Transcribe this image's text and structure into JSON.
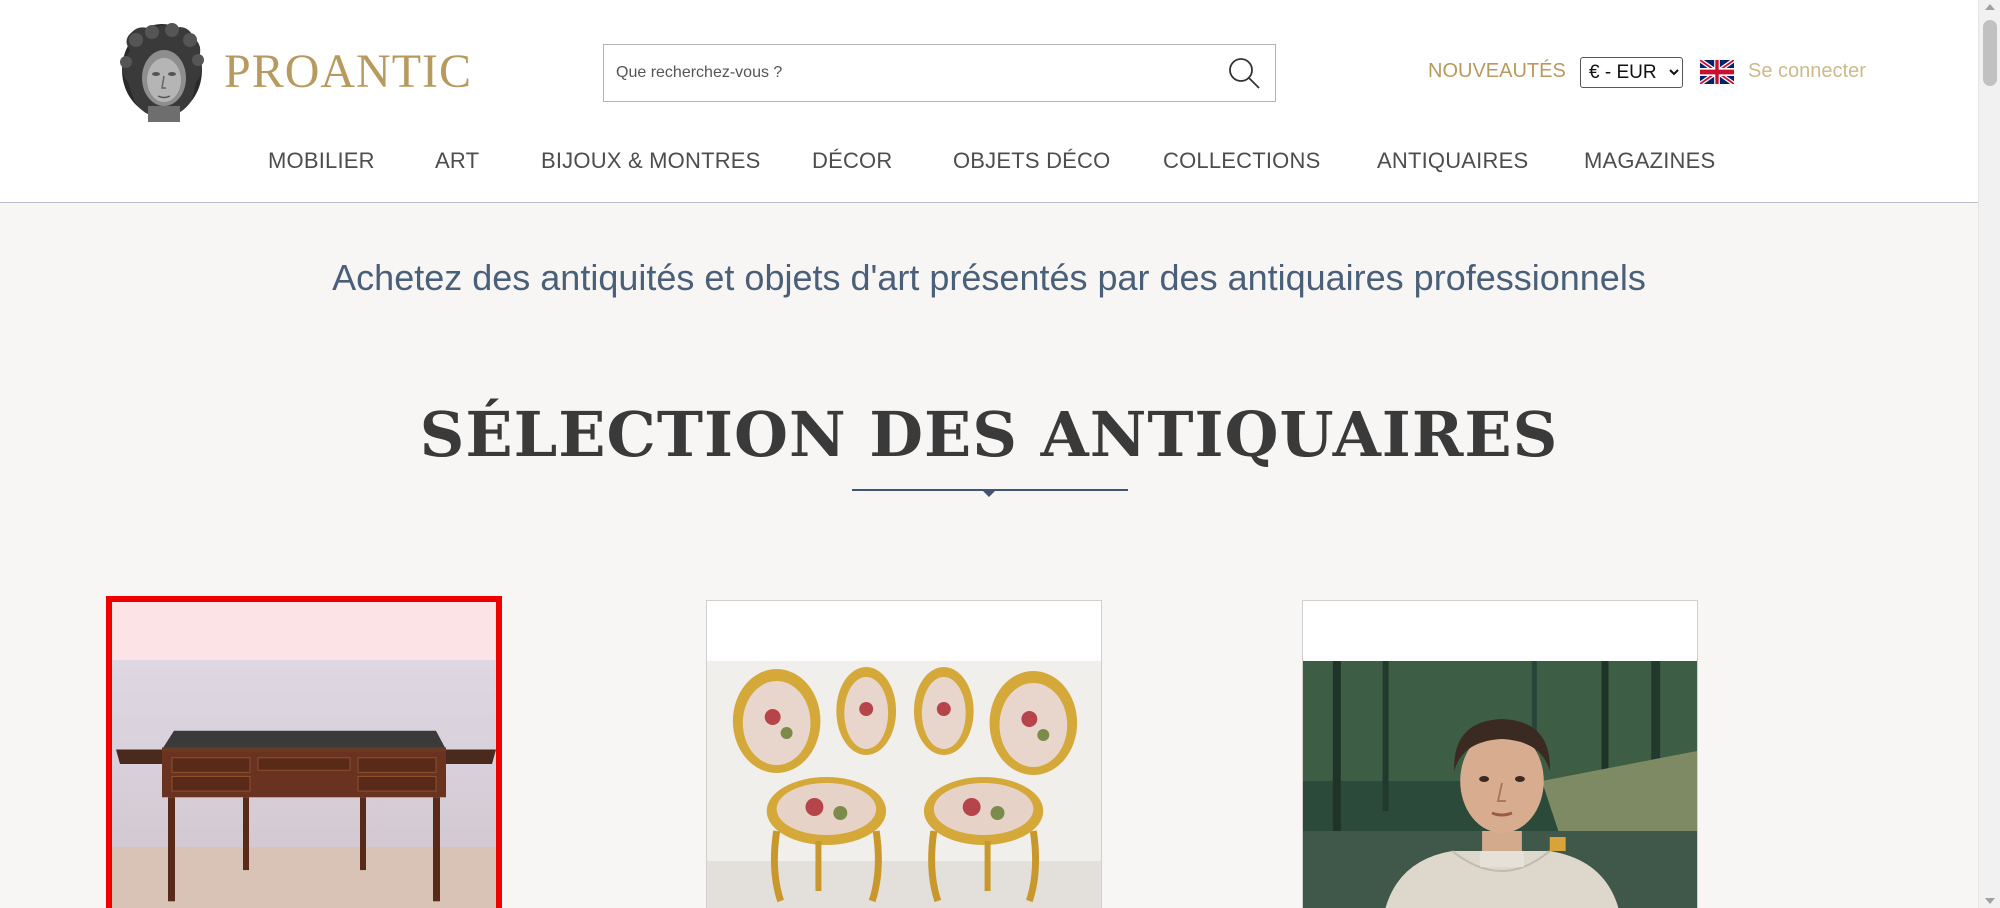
{
  "header": {
    "logo_text": "PROANTIC",
    "search_placeholder": "Que recherchez-vous ?",
    "search_icon": "search-icon",
    "nouveautes_label": "NOUVEAUTÉS",
    "currency_selected": "€ - EUR",
    "language_flag": "uk-flag-icon",
    "login_label": "Se connecter"
  },
  "nav": {
    "items": [
      {
        "label": "MOBILIER"
      },
      {
        "label": "ART"
      },
      {
        "label": "BIJOUX & MONTRES"
      },
      {
        "label": "DÉCOR"
      },
      {
        "label": "OBJETS DÉCO"
      },
      {
        "label": "COLLECTIONS"
      },
      {
        "label": "ANTIQUAIRES"
      },
      {
        "label": "MAGAZINES"
      }
    ]
  },
  "main": {
    "tagline": "Achetez des antiquités et objets d'art présentés par des antiquaires professionnels",
    "section_title": "SÉLECTION DES ANTIQUAIRES",
    "cards": [
      {
        "image": "mahogany-writing-desk-image",
        "selected": true
      },
      {
        "image": "gilded-armchairs-image",
        "selected": false
      },
      {
        "image": "woman-portrait-painting-image",
        "selected": false
      }
    ]
  },
  "colors": {
    "brand_gold": "#b79a5f",
    "login_gold": "#cdb98d",
    "tagline_blue": "#4a5f78",
    "highlight_red": "#ee0000"
  }
}
